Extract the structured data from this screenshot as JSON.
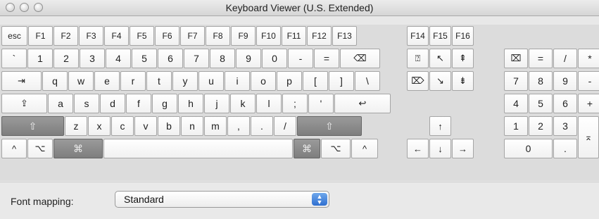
{
  "window": {
    "title": "Keyboard Viewer (U.S. Extended)"
  },
  "fn_row": [
    "esc",
    "F1",
    "F2",
    "F3",
    "F4",
    "F5",
    "F6",
    "F7",
    "F8",
    "F9",
    "F10",
    "F11",
    "F12",
    "F13"
  ],
  "fn_ext": [
    "F14",
    "F15",
    "F16"
  ],
  "num_row": [
    "`",
    "1",
    "2",
    "3",
    "4",
    "5",
    "6",
    "7",
    "8",
    "9",
    "0",
    "-",
    "=",
    "⌫"
  ],
  "q_row": [
    "⇥",
    "q",
    "w",
    "e",
    "r",
    "t",
    "y",
    "u",
    "i",
    "o",
    "p",
    "[",
    "]",
    "\\"
  ],
  "a_row": [
    "⇪",
    "a",
    "s",
    "d",
    "f",
    "g",
    "h",
    "j",
    "k",
    "l",
    ";",
    "'",
    "↩"
  ],
  "z_row": [
    "⇧",
    "z",
    "x",
    "c",
    "v",
    "b",
    "n",
    "m",
    ",",
    ".",
    "/",
    "⇧"
  ],
  "bottom_row": {
    "ctrl_left": "^",
    "opt_left": "⌥",
    "cmd_left": "⌘",
    "cmd_right": "⌘",
    "opt_right": "⌥",
    "ctrl_right": "^"
  },
  "nav_top": [
    "⍰",
    "↖",
    "⇞"
  ],
  "nav_mid": [
    "⌦",
    "↘",
    "⇟"
  ],
  "arrows": {
    "up": "↑",
    "left": "←",
    "down": "↓",
    "right": "→"
  },
  "keypad": {
    "row1": [
      "⌧",
      "=",
      "/",
      "*"
    ],
    "row2": [
      "7",
      "8",
      "9",
      "-"
    ],
    "row3": [
      "4",
      "5",
      "6",
      "+"
    ],
    "row4": [
      "1",
      "2",
      "3"
    ],
    "row5": [
      "0",
      "."
    ],
    "enter": "⌅"
  },
  "font_mapping": {
    "label": "Font mapping:",
    "value": "Standard",
    "arrow_up": "▲",
    "arrow_down": "▼"
  }
}
